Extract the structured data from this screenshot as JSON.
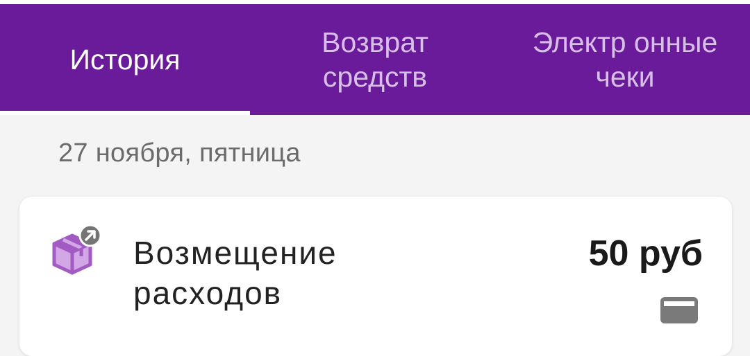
{
  "tabs": [
    {
      "label": "История",
      "active": true
    },
    {
      "label": "Возврат средств",
      "active": false
    },
    {
      "label": "Электр онные чеки",
      "active": false
    }
  ],
  "colors": {
    "tabbar_bg": "#6a1b9a",
    "tab_active_text": "#ffffff",
    "tab_inactive_text": "#d8bfe8",
    "page_bg": "#f4f4f4",
    "icon_purple": "#a35bc4",
    "payment_icon_gray": "#7a7a7a"
  },
  "history": {
    "date_header": "27 ноября, пятница",
    "items": [
      {
        "title": "Возмещение расходов",
        "amount": "50 руб",
        "icon": "package-box-icon",
        "badge_icon": "arrow-out-icon",
        "payment_icon": "credit-card-icon"
      }
    ]
  }
}
